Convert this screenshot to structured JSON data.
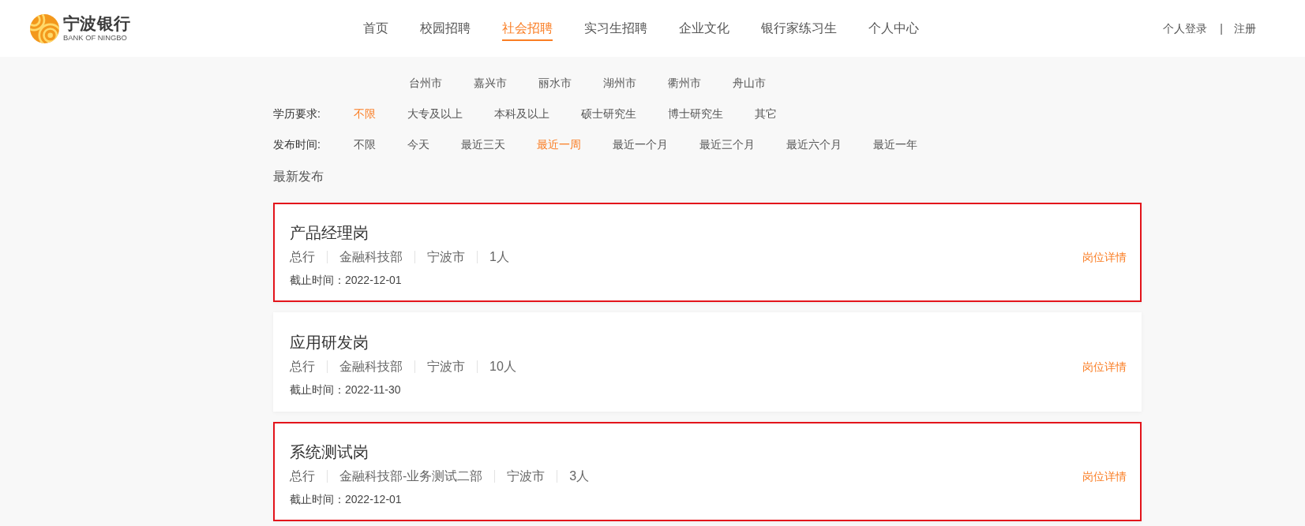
{
  "header": {
    "logo": {
      "name": "宁波银行",
      "subtitle": "BANK OF NINGBO"
    },
    "nav": [
      {
        "label": "首页",
        "selected": false
      },
      {
        "label": "校园招聘",
        "selected": false
      },
      {
        "label": "社会招聘",
        "selected": true
      },
      {
        "label": "实习生招聘",
        "selected": false
      },
      {
        "label": "企业文化",
        "selected": false
      },
      {
        "label": "银行家练习生",
        "selected": false
      },
      {
        "label": "个人中心",
        "selected": false
      }
    ],
    "account_links": [
      {
        "kind": "link",
        "text": "个人登录"
      },
      {
        "kind": "separator",
        "text": "|"
      },
      {
        "kind": "link",
        "text": "注册"
      }
    ]
  },
  "filters": [
    {
      "options": [
        {
          "text": "台州市",
          "selected": false
        },
        {
          "text": "嘉兴市",
          "selected": false
        },
        {
          "text": "丽水市",
          "selected": false
        },
        {
          "text": "湖州市",
          "selected": false
        },
        {
          "text": "衢州市",
          "selected": false
        },
        {
          "text": "舟山市",
          "selected": false
        }
      ]
    },
    {
      "label": "学历要求:",
      "options": [
        {
          "text": "不限",
          "selected": true
        },
        {
          "text": "大专及以上",
          "selected": false
        },
        {
          "text": "本科及以上",
          "selected": false
        },
        {
          "text": "硕士研究生",
          "selected": false
        },
        {
          "text": "博士研究生",
          "selected": false
        },
        {
          "text": "其它",
          "selected": false
        }
      ]
    },
    {
      "label": "发布时间:",
      "options": [
        {
          "text": "不限",
          "selected": false
        },
        {
          "text": "今天",
          "selected": false
        },
        {
          "text": "最近三天",
          "selected": false
        },
        {
          "text": "最近一周",
          "selected": true
        },
        {
          "text": "最近一个月",
          "selected": false
        },
        {
          "text": "最近三个月",
          "selected": false
        },
        {
          "text": "最近六个月",
          "selected": false
        },
        {
          "text": "最近一年",
          "selected": false
        }
      ]
    }
  ],
  "sort": {
    "label": "最新发布"
  },
  "jobs": [
    {
      "title": "产品经理岗",
      "highlighted": true,
      "tags": [
        "总行",
        "金融科技部",
        "宁波市",
        "1人"
      ],
      "link": "岗位详情",
      "deadline": "截止时间：2022-12-01"
    },
    {
      "title": "应用研发岗",
      "highlighted": false,
      "tags": [
        "总行",
        "金融科技部",
        "宁波市",
        "10人"
      ],
      "link": "岗位详情",
      "deadline": "截止时间：2022-11-30"
    },
    {
      "title": "系统测试岗",
      "highlighted": true,
      "tags": [
        "总行",
        "金融科技部-业务测试二部",
        "宁波市",
        "3人"
      ],
      "link": "岗位详情",
      "deadline": "截止时间：2022-12-01"
    }
  ]
}
